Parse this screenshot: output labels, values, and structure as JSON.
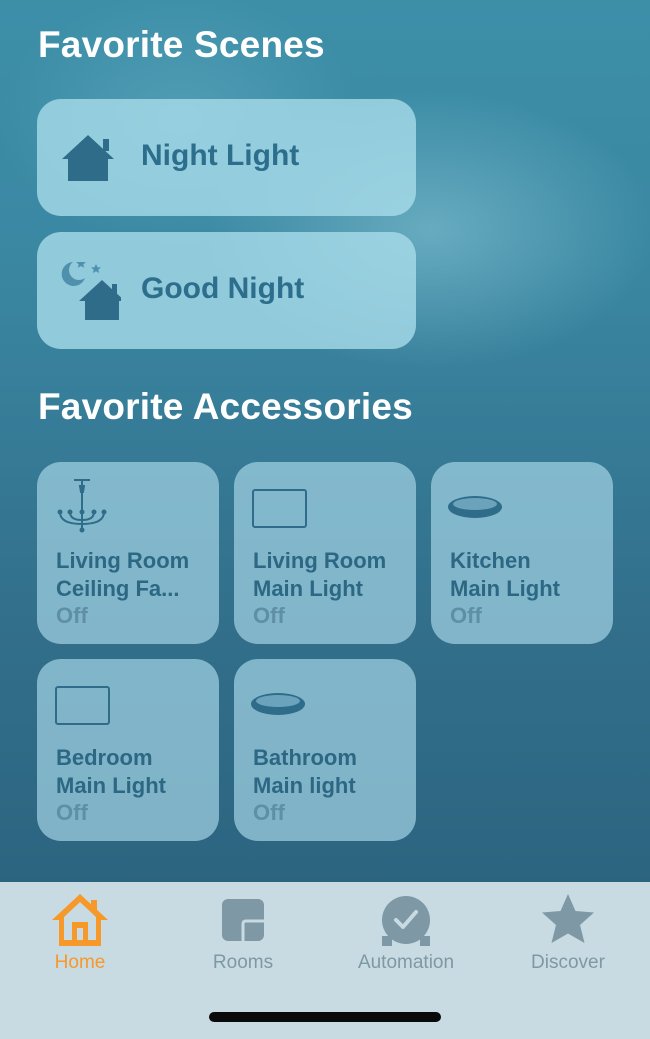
{
  "sections": {
    "scenes_title": "Favorite Scenes",
    "accessories_title": "Favorite Accessories"
  },
  "scenes": [
    {
      "label": "Night Light",
      "icon": "house-icon"
    },
    {
      "label": "Good Night",
      "icon": "moon-stars-house-icon"
    }
  ],
  "accessories": [
    {
      "name_line1": "Living Room",
      "name_line2": "Ceiling Fa...",
      "status": "Off",
      "icon": "chandelier-icon"
    },
    {
      "name_line1": "Living Room",
      "name_line2": "Main Light",
      "status": "Off",
      "icon": "panel-light-icon"
    },
    {
      "name_line1": "Kitchen",
      "name_line2": "Main Light",
      "status": "Off",
      "icon": "ceiling-light-icon"
    },
    {
      "name_line1": "Bedroom",
      "name_line2": "Main Light",
      "status": "Off",
      "icon": "panel-light-icon"
    },
    {
      "name_line1": "Bathroom",
      "name_line2": "Main light",
      "status": "Off",
      "icon": "ceiling-light-icon"
    }
  ],
  "tabs": [
    {
      "label": "Home",
      "icon": "home-icon",
      "active": true
    },
    {
      "label": "Rooms",
      "icon": "rooms-icon",
      "active": false
    },
    {
      "label": "Automation",
      "icon": "clock-icon",
      "active": false
    },
    {
      "label": "Discover",
      "icon": "star-icon",
      "active": false
    }
  ],
  "colors": {
    "active_tab": "#f7982a",
    "inactive_tab": "#7e98a5",
    "tile_text": "#2c6884",
    "status_text": "#5f8fa5",
    "section_title": "#ffffff"
  }
}
